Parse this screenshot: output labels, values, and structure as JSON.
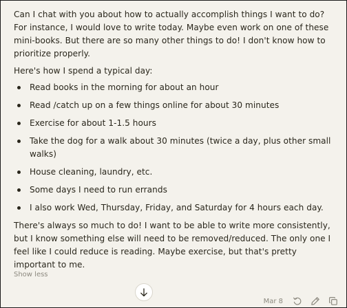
{
  "message": {
    "paragraph_1": "Can I chat with you about how to actually accomplish things I want to do? For instance, I would love to write today. Maybe even work on one of these mini-books. But there are so many other things to do! I don't know how to prioritize properly.",
    "paragraph_2": "Here's how I spend a typical day:",
    "bullets": [
      "Read books in the morning for about an hour",
      "Read /catch up on a few things online for about 30 minutes",
      "Exercise for about 1-1.5 hours",
      "Take the dog for a walk about 30 minutes (twice a day, plus other small walks)",
      "House cleaning, laundry, etc.",
      "Some days I need to run errands",
      "I also work Wed, Thursday, Friday, and Saturday for 4 hours each day."
    ],
    "paragraph_3": "There's always so much to do! I want to be able to write more consistently, but I know something else will need to be removed/reduced. The only one I feel like I could reduce is reading. Maybe exercise, but that's pretty important to me."
  },
  "show_less_label": "Show less",
  "footer": {
    "date": "Mar 8"
  },
  "icons": {
    "scroll": "arrow-down-icon",
    "retry": "retry-icon",
    "edit": "pencil-icon",
    "copy": "copy-icon"
  },
  "colors": {
    "background": "#f4f2ec",
    "text": "#29261b",
    "muted": "#8c897f"
  }
}
